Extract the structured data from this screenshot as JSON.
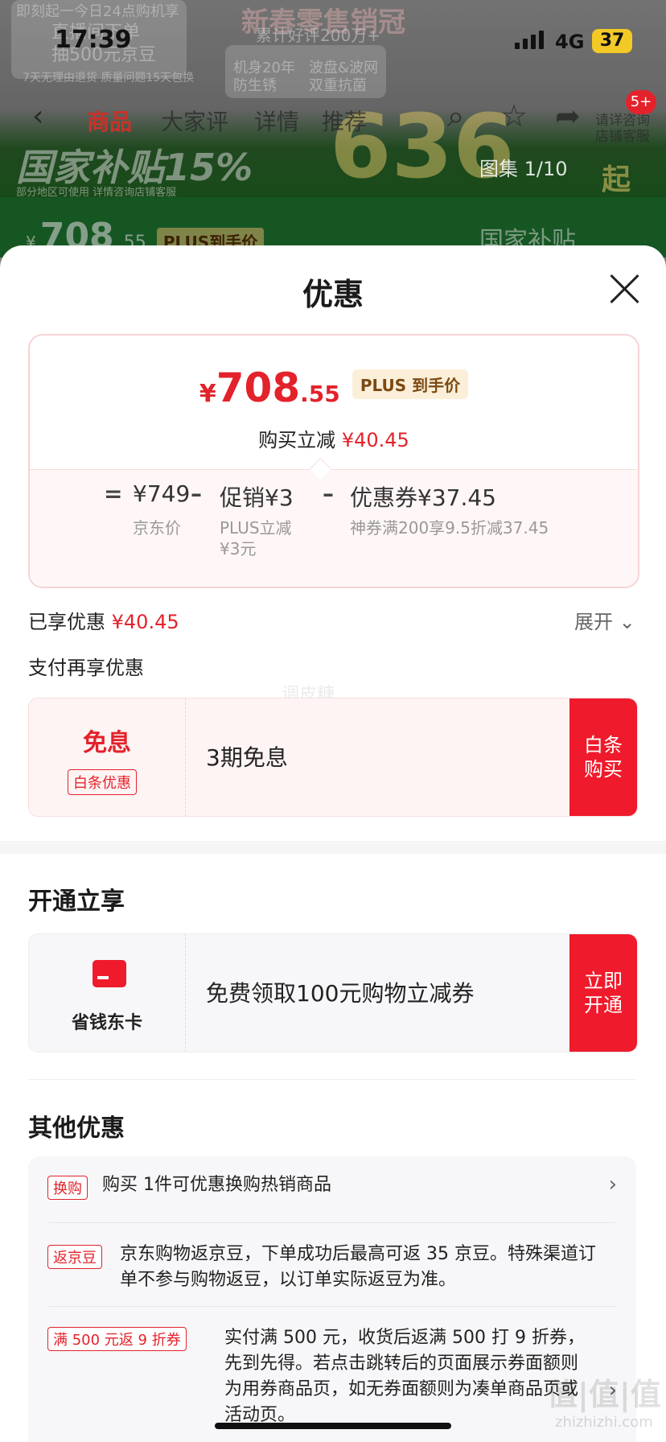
{
  "status_bar": {
    "time": "17:39",
    "network": "4G",
    "battery": "37"
  },
  "background": {
    "banner_texts": [
      "即刻起一今日24点购机享",
      "直播间下单",
      "抽500元京豆",
      "新春零售销冠",
      "累计好评200万+",
      "机身20年",
      "防生锈",
      "波盘&波网",
      "双重抗菌",
      "7天无理由退货 质量问题15天包换",
      "国家补贴15%",
      "部分地区可使用 详情咨询店铺客服",
      "636",
      "起"
    ],
    "nav_tabs": [
      {
        "label": "商品",
        "active": true
      },
      {
        "label": "大家评",
        "active": false
      },
      {
        "label": "详情",
        "active": false
      },
      {
        "label": "推荐",
        "active": false
      }
    ],
    "message_badge": "5+",
    "gallery": "图集 1/10",
    "service_label": "请详咨询店铺客服",
    "price_strip": {
      "yen": "¥",
      "int": "708",
      "dec": ".55",
      "tag": "PLUS到手价",
      "subsidy": "国家补贴"
    }
  },
  "sheet": {
    "title": "优惠",
    "price_card": {
      "yen": "¥",
      "price_int": "708",
      "price_dec": ".55",
      "plus_tag": "PLUS 到手价",
      "instant_label": "购买立减",
      "instant_value": "¥40.45",
      "breakdown": [
        {
          "op": "=",
          "value": "¥749",
          "sub": "京东价"
        },
        {
          "op": "–",
          "value": "促销¥3",
          "sub": "PLUS立减 ¥3元"
        },
        {
          "op": "–",
          "value": "优惠券¥37.45",
          "sub": "神券满200享9.5折减37.45"
        }
      ]
    },
    "enjoyed_label": "已享优惠",
    "enjoyed_value": "¥40.45",
    "expand_label": "展开",
    "pay_title": "支付再享优惠",
    "watermark": "调皮糖",
    "baitiao_offer": {
      "title": "免息",
      "tag": "白条优惠",
      "desc": "3期免息",
      "button": "白条 购买"
    },
    "open_section_title": "开通立享",
    "card_offer": {
      "label": "省钱东卡",
      "desc": "免费领取100元购物立减券",
      "button": "立即 开通"
    },
    "other_section_title": "其他优惠",
    "other_offers": [
      {
        "tag": "换购",
        "text": "购买 1件可优惠换购热销商品"
      },
      {
        "tag": "返京豆",
        "text": "京东购物返京豆，下单成功后最高可返 35 京豆。特殊渠道订单不参与购物返豆，以订单实际返豆为准。"
      },
      {
        "tag": "满 500 元返 9 折券",
        "text": "实付满 500 元，收货后返满 500 打 9 折券，先到先得。若点击跳转后的页面展示券面额则为用券商品页，如无券面额则为凑单商品页或活动页。"
      }
    ]
  },
  "corner_watermark": {
    "logo": "值|值|值",
    "site": "zhizhizhi.com"
  },
  "colors": {
    "accent_red": "#e3222b",
    "button_red": "#ef1a2b",
    "plus_gold": "#7b4a12"
  }
}
